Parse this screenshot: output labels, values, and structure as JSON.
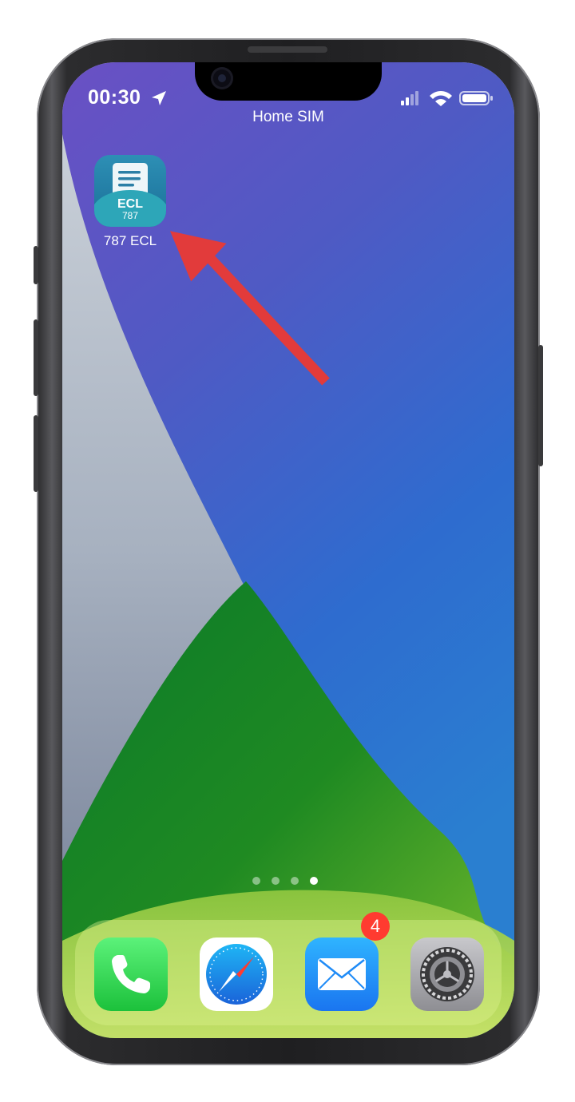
{
  "status_bar": {
    "time": "00:30",
    "carrier": "Home SIM"
  },
  "home": {
    "apps": [
      {
        "label": "787 ECL",
        "icon": "ecl-document-icon",
        "icon_text_top": "ECL",
        "icon_text_bottom": "787"
      }
    ],
    "page_dots": {
      "count": 4,
      "active_index": 3
    }
  },
  "dock": {
    "apps": [
      {
        "name": "phone-app-icon"
      },
      {
        "name": "safari-app-icon"
      },
      {
        "name": "mail-app-icon",
        "badge": "4"
      },
      {
        "name": "settings-app-icon"
      }
    ]
  },
  "annotation": {
    "color": "#e23b3b"
  }
}
